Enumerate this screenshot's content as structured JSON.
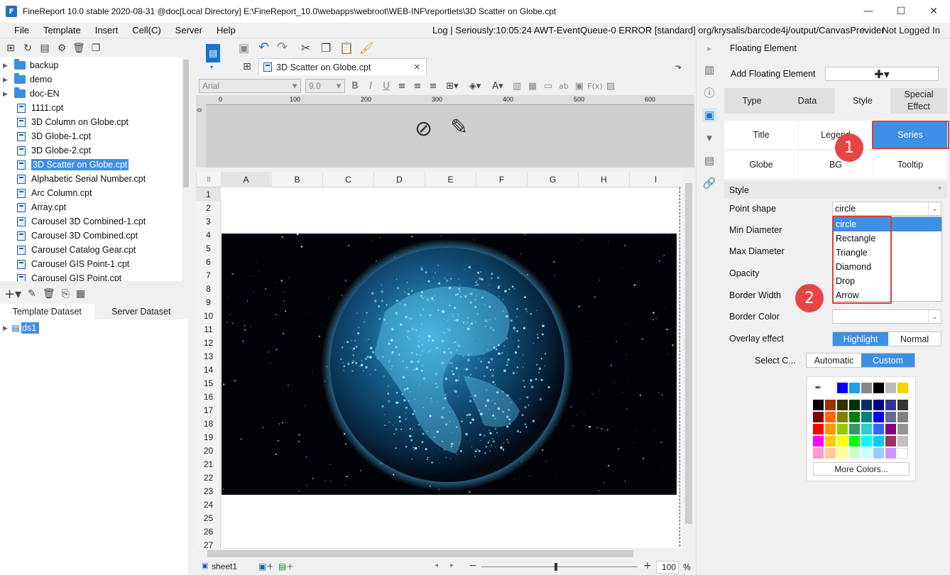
{
  "window": {
    "title": "FineReport 10.0 stable 2020-08-31 @doc[Local Directory]    E:\\FineReport_10.0\\webapps\\webroot\\WEB-INF\\reportlets\\3D Scatter on Globe.cpt"
  },
  "menu": {
    "items": [
      "File",
      "Template",
      "Insert",
      "Cell(C)",
      "Server",
      "Help"
    ],
    "log": "Log | Seriously:10:05:24 AWT-EventQueue-0 ERROR [standard] org/krysalis/barcode4j/output/CanvasProvider",
    "login": "Not Logged In"
  },
  "tree": {
    "folders": [
      "backup",
      "demo",
      "doc-EN"
    ],
    "files": [
      "1111.cpt",
      "3D Column on Globe.cpt",
      "3D Globe-1.cpt",
      "3D Globe-2.cpt",
      "3D Scatter on Globe.cpt",
      "Alphabetic Serial Number.cpt",
      "Arc Column.cpt",
      "Array.cpt",
      "Carousel 3D Combined-1.cpt",
      "Carousel 3D Combined.cpt",
      "Carousel Catalog Gear.cpt",
      "Carousel GIS Point-1.cpt",
      "Carousel GIS Point.cpt"
    ],
    "selected_file": "3D Scatter on Globe.cpt"
  },
  "dataset": {
    "tabs": [
      "Template Dataset",
      "Server Dataset"
    ],
    "items": [
      "ds1"
    ]
  },
  "editor": {
    "file_tab": "3D Scatter on Globe.cpt",
    "font": "Arial",
    "size": "9.0",
    "ruler_marks": [
      "0",
      "100",
      "200",
      "300",
      "400",
      "500",
      "600"
    ],
    "columns": [
      "A",
      "B",
      "C",
      "D",
      "E",
      "F",
      "G",
      "H",
      "I"
    ],
    "rows": [
      "1",
      "2",
      "3",
      "4",
      "5",
      "6",
      "7",
      "8",
      "9",
      "10",
      "11",
      "12",
      "13",
      "14",
      "15",
      "16",
      "17",
      "18",
      "19",
      "20",
      "21",
      "22",
      "23",
      "24",
      "25",
      "26",
      "27"
    ],
    "sheet": "sheet1",
    "zoom": "100",
    "zoom_unit": "%"
  },
  "panel": {
    "title": "Floating Element",
    "add_label": "Add Floating Element",
    "top_tabs": [
      "Type",
      "Data",
      "Style",
      "Special Effect"
    ],
    "sub_tabs": [
      "Title",
      "Legend",
      "Series",
      "Globe",
      "BG",
      "Tooltip"
    ],
    "section": "Style",
    "labels": {
      "point_shape": "Point shape",
      "min_diameter": "Min Diameter",
      "max_diameter": "Max Diameter",
      "opacity": "Opacity",
      "border_width": "Border Width",
      "border_color": "Border Color",
      "overlay": "Overlay effect",
      "select_color": "Select C..."
    },
    "point_shape_value": "circle",
    "shape_options": [
      "circle",
      "Rectangle",
      "Triangle",
      "Diamond",
      "Drop",
      "Arrow"
    ],
    "overlay_options": [
      "Highlight",
      "Normal"
    ],
    "color_mode_options": [
      "Automatic",
      "Custom"
    ],
    "more_colors": "More Colors...",
    "palette_top": [
      "#0000ff",
      "#1e9ee6",
      "#888888",
      "#000000",
      "#bbbbbb",
      "#f5d400"
    ],
    "palette": [
      [
        "#000000",
        "#993300",
        "#333300",
        "#003300",
        "#003366",
        "#000080",
        "#333399",
        "#333333"
      ],
      [
        "#800000",
        "#ff6600",
        "#808000",
        "#008000",
        "#008080",
        "#0000ff",
        "#666699",
        "#808080"
      ],
      [
        "#ff0000",
        "#ff9900",
        "#99cc00",
        "#339966",
        "#33cccc",
        "#3366ff",
        "#800080",
        "#969696"
      ],
      [
        "#ff00ff",
        "#ffcc00",
        "#ffff00",
        "#00ff00",
        "#00ffff",
        "#00ccff",
        "#993366",
        "#c0c0c0"
      ],
      [
        "#ff99cc",
        "#ffcc99",
        "#ffff99",
        "#ccffcc",
        "#ccffff",
        "#99ccff",
        "#cc99ff",
        "#ffffff"
      ]
    ]
  },
  "annotations": {
    "badge1": "1",
    "badge2": "2",
    "accent": "#e03c3c"
  }
}
